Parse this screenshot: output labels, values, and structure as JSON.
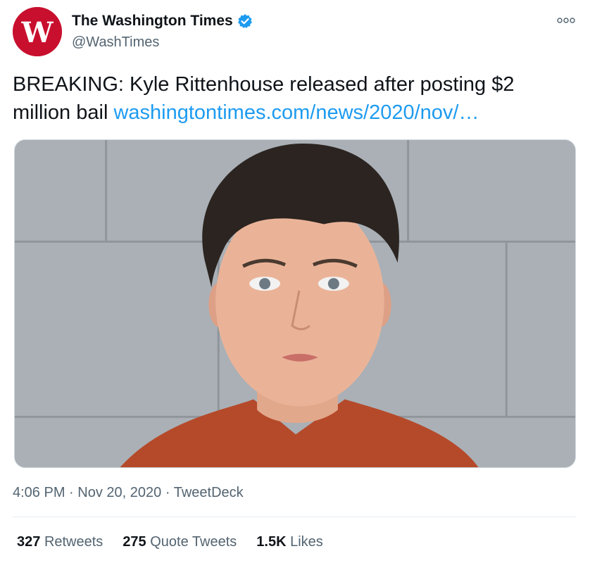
{
  "account": {
    "display_name": "The Washington Times",
    "handle": "@WashTimes",
    "avatar_icon": "washington-times-w-logo",
    "verified_icon": "verified-badge-icon",
    "brand_color": "#c8102e",
    "verified_color": "#1d9bf0"
  },
  "more_icon": "more-options-icon",
  "tweet": {
    "text": "BREAKING: Kyle Rittenhouse released after posting $2 million bail ",
    "link": "washingtontimes.com/news/2020/nov/…",
    "link_color": "#1d9bf0"
  },
  "media": {
    "type": "photo"
  },
  "meta": {
    "time": "4:06 PM",
    "separator": "·",
    "date": "Nov 20, 2020",
    "source": "TweetDeck"
  },
  "stats": {
    "retweets_count": "327",
    "retweets_label": "Retweets",
    "quote_count": "275",
    "quote_label": "Quote Tweets",
    "likes_count": "1.5K",
    "likes_label": "Likes"
  }
}
